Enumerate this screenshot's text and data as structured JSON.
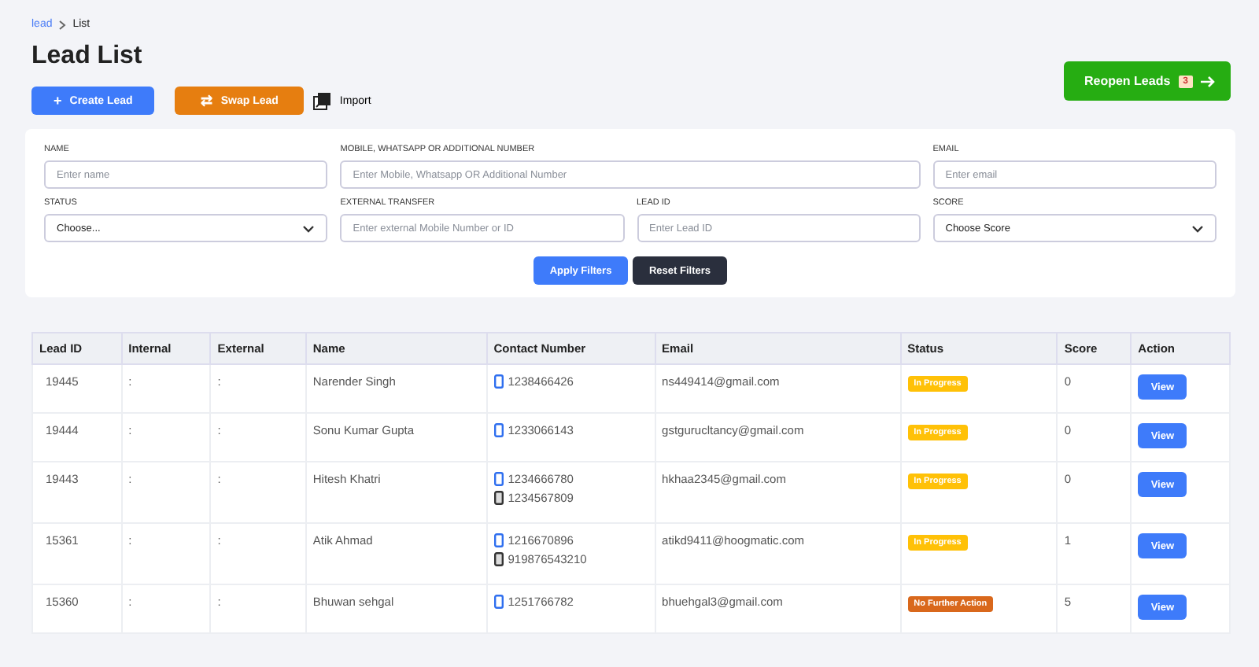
{
  "breadcrumb": [
    {
      "label": "lead",
      "link": true
    },
    {
      "label": "List",
      "link": false
    }
  ],
  "title": "Lead List",
  "actions": [
    {
      "kind": "create",
      "label": "Create Lead",
      "icon": "+"
    },
    {
      "kind": "swap",
      "label": "Swap Lead",
      "icon": "⇄"
    },
    {
      "kind": "import",
      "label": "Import"
    }
  ],
  "reopen": {
    "label": "Reopen Leads",
    "count": "3"
  },
  "filters": [
    {
      "label": "NAME",
      "placeholder": "Enter name",
      "kind": "input"
    },
    {
      "label": "MOBILE, WHATSAPP OR ADDITIONAL NUMBER",
      "placeholder": "Enter Mobile, Whatsapp OR Additional Number",
      "kind": "input"
    },
    {
      "label": "EMAIL",
      "placeholder": "Enter email",
      "kind": "input"
    },
    {
      "label": "STATUS",
      "value": "Choose...",
      "kind": "select"
    },
    {
      "label": "EXTERNAL TRANSFER",
      "placeholder": "Enter external Mobile Number or ID",
      "kind": "input"
    },
    {
      "label": "LEAD ID",
      "placeholder": "Enter Lead ID",
      "kind": "input"
    },
    {
      "label": "SCORE",
      "value": "Choose Score",
      "kind": "select"
    }
  ],
  "filter_buttons": [
    {
      "kind": "apply",
      "label": "Apply Filters"
    },
    {
      "kind": "reset",
      "label": "Reset Filters"
    }
  ],
  "table": {
    "columns": [
      "Lead ID",
      "Internal",
      "External",
      "Name",
      "Contact Number",
      "Email",
      "Status",
      "Score",
      "Action"
    ],
    "rows": [
      {
        "lead_id": "19445",
        "internal": ":",
        "external": ":",
        "name": "Narender Singh",
        "contacts": [
          {
            "kind": "mobile",
            "number": "1238466426"
          }
        ],
        "email": "ns449414@gmail.com",
        "status": {
          "label": "In Progress",
          "color": "#ffc107"
        },
        "score": "0",
        "action": "View"
      },
      {
        "lead_id": "19444",
        "internal": ":",
        "external": ":",
        "name": "Sonu Kumar Gupta",
        "contacts": [
          {
            "kind": "mobile",
            "number": "1233066143"
          }
        ],
        "email": "gstgurucltancy@gmail.com",
        "status": {
          "label": "In Progress",
          "color": "#ffc107"
        },
        "score": "0",
        "action": "View"
      },
      {
        "lead_id": "19443",
        "internal": ":",
        "external": ":",
        "name": "Hitesh Khatri",
        "contacts": [
          {
            "kind": "mobile",
            "number": "1234666780"
          },
          {
            "kind": "alternate",
            "number": "1234567809"
          }
        ],
        "email": "hkhaa2345@gmail.com",
        "status": {
          "label": "In Progress",
          "color": "#ffc107"
        },
        "score": "0",
        "action": "View"
      },
      {
        "lead_id": "15361",
        "internal": ":",
        "external": ":",
        "name": "Atik Ahmad",
        "contacts": [
          {
            "kind": "mobile",
            "number": "1216670896"
          },
          {
            "kind": "alternate",
            "number": "919876543210"
          }
        ],
        "email": "atikd9411@hoogmatic.com",
        "status": {
          "label": "In Progress",
          "color": "#ffc107"
        },
        "score": "1",
        "action": "View"
      },
      {
        "lead_id": "15360",
        "internal": ":",
        "external": ":",
        "name": "Bhuwan sehgal",
        "contacts": [
          {
            "kind": "mobile",
            "number": "1251766782"
          }
        ],
        "email": "bhuehgal3@gmail.com",
        "status": {
          "label": "No Further Action",
          "color": "#d9681c"
        },
        "score": "5",
        "action": "View"
      }
    ]
  }
}
